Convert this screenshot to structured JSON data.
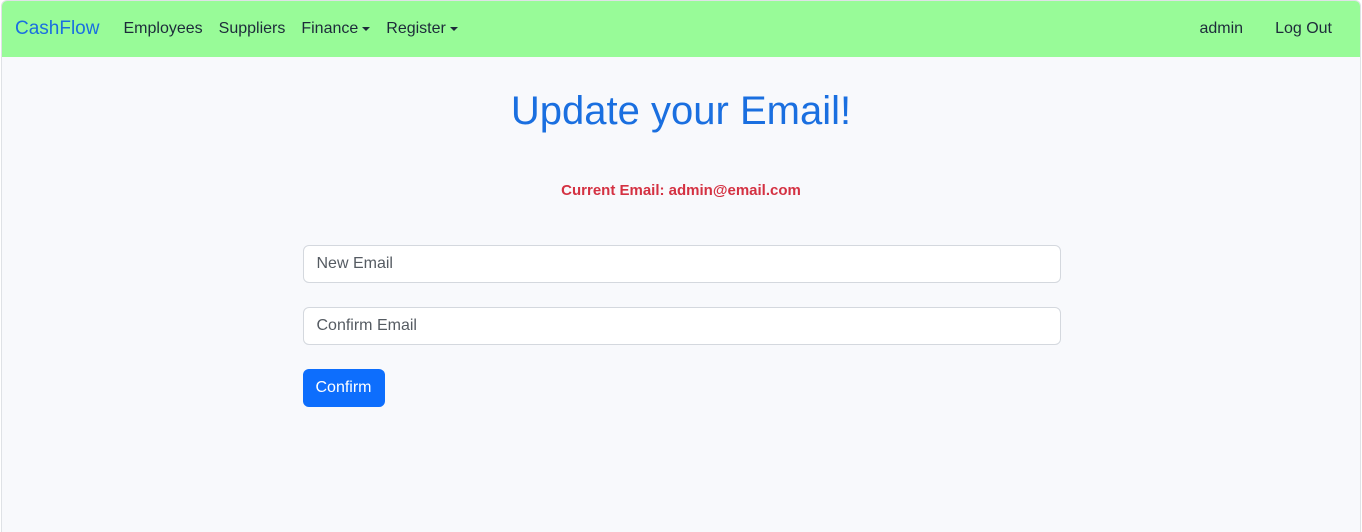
{
  "navbar": {
    "brand": "CashFlow",
    "links": {
      "employees": "Employees",
      "suppliers": "Suppliers",
      "finance": "Finance",
      "register": "Register"
    },
    "user": "admin",
    "logout": "Log Out"
  },
  "main": {
    "title": "Update your Email!",
    "current_email": "Current Email: admin@email.com",
    "new_email_placeholder": "New Email",
    "confirm_email_placeholder": "Confirm Email",
    "confirm_button": "Confirm"
  },
  "colors": {
    "navbar_bg": "#98fb98",
    "brand": "#1a6fe0",
    "title": "#1a6fe0",
    "current_email": "#d43142",
    "primary_button": "#0d6efd",
    "page_bg": "#f8f9fc"
  },
  "icons": {
    "finance_dropdown": "caret-down-icon",
    "register_dropdown": "caret-down-icon"
  }
}
